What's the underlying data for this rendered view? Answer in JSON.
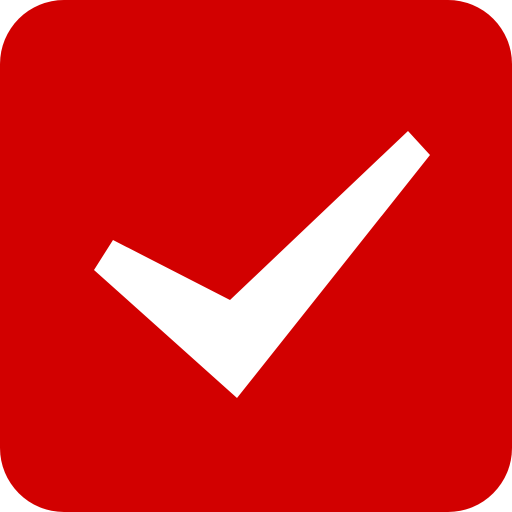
{
  "app_icon": {
    "icon_name": "checkmark-icon",
    "colors": {
      "background": "#d20000",
      "checkmark": "#ffffff"
    }
  }
}
